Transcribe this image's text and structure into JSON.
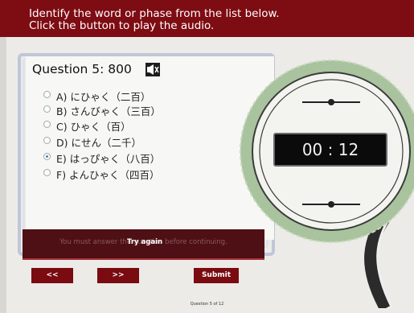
{
  "header": {
    "instruction_line1": "Identify the word or phase from the list below.",
    "instruction_line2": "Click the button to play the audio."
  },
  "question": {
    "title": "Question 5: 800",
    "audio_icon": "speaker-icon",
    "options": [
      {
        "label": "A) にひゃく（二百）",
        "selected": false
      },
      {
        "label": "B) さんびゃく（三百）",
        "selected": false
      },
      {
        "label": "C) ひゃく（百）",
        "selected": false
      },
      {
        "label": "D) にせん（二千）",
        "selected": false
      },
      {
        "label": "E) はっぴゃく（八百）",
        "selected": true
      },
      {
        "label": "F) よんひゃく（四百）",
        "selected": false
      }
    ]
  },
  "timer": {
    "value": "00 : 12"
  },
  "feedback": {
    "message": "You must answer the question before continuing.",
    "try_again": "Try again"
  },
  "nav": {
    "prev_label": "<<",
    "next_label": ">>",
    "submit_label": "Submit"
  },
  "footer": {
    "progress": "Question 5 of 12"
  },
  "colors": {
    "header": "#7e0c13",
    "button": "#7a0b11",
    "badge": "#a8c39d",
    "feedback": "#4e1014"
  }
}
